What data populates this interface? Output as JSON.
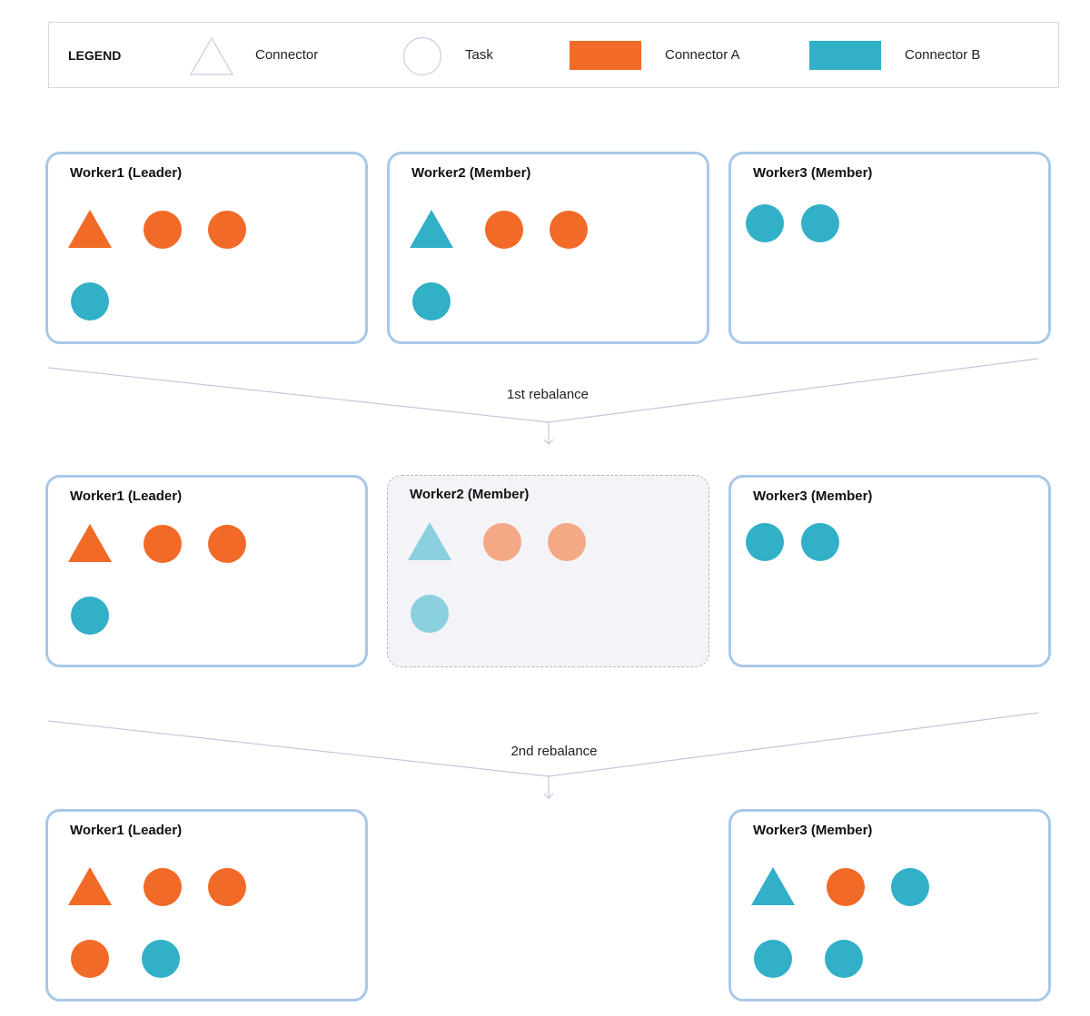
{
  "colors": {
    "connector_a": "#f26a27",
    "connector_b": "#31b0c8",
    "connector_a_faded": "#f3a986",
    "connector_b_faded": "#8ad0de",
    "border": "#a9c8e8",
    "line": "#c4c7dc"
  },
  "legend": {
    "title": "LEGEND",
    "items": [
      {
        "label": "Connector",
        "icon": "triangle-outline-icon"
      },
      {
        "label": "Task",
        "icon": "circle-outline-icon"
      },
      {
        "label": "Connector A",
        "icon": "orange-swatch"
      },
      {
        "label": "Connector B",
        "icon": "teal-swatch"
      }
    ]
  },
  "transitions": [
    {
      "label": "1st rebalance"
    },
    {
      "label": "2nd rebalance"
    }
  ],
  "stages": [
    {
      "workers": [
        {
          "title": "Worker1 (Leader)",
          "state": "active",
          "rows": [
            [
              {
                "type": "connector",
                "owner": "a"
              },
              {
                "type": "task",
                "owner": "a"
              },
              {
                "type": "task",
                "owner": "a"
              }
            ],
            [
              {
                "type": "task",
                "owner": "b"
              }
            ]
          ]
        },
        {
          "title": "Worker2 (Member)",
          "state": "active",
          "rows": [
            [
              {
                "type": "connector",
                "owner": "b"
              },
              {
                "type": "task",
                "owner": "a"
              },
              {
                "type": "task",
                "owner": "a"
              }
            ],
            [
              {
                "type": "task",
                "owner": "b"
              }
            ]
          ]
        },
        {
          "title": "Worker3 (Member)",
          "state": "active",
          "rows": [
            [
              {
                "type": "task",
                "owner": "b"
              },
              {
                "type": "task",
                "owner": "b"
              }
            ]
          ]
        }
      ]
    },
    {
      "workers": [
        {
          "title": "Worker1 (Leader)",
          "state": "active",
          "rows": [
            [
              {
                "type": "connector",
                "owner": "a"
              },
              {
                "type": "task",
                "owner": "a"
              },
              {
                "type": "task",
                "owner": "a"
              }
            ],
            [
              {
                "type": "task",
                "owner": "b"
              }
            ]
          ]
        },
        {
          "title": "Worker2 (Member)",
          "state": "lost",
          "rows": [
            [
              {
                "type": "connector",
                "owner": "b"
              },
              {
                "type": "task",
                "owner": "a"
              },
              {
                "type": "task",
                "owner": "a"
              }
            ],
            [
              {
                "type": "task",
                "owner": "b"
              }
            ]
          ]
        },
        {
          "title": "Worker3 (Member)",
          "state": "active",
          "rows": [
            [
              {
                "type": "task",
                "owner": "b"
              },
              {
                "type": "task",
                "owner": "b"
              }
            ]
          ]
        }
      ]
    },
    {
      "workers": [
        {
          "title": "Worker1 (Leader)",
          "state": "active",
          "rows": [
            [
              {
                "type": "connector",
                "owner": "a"
              },
              {
                "type": "task",
                "owner": "a"
              },
              {
                "type": "task",
                "owner": "a"
              }
            ],
            [
              {
                "type": "task",
                "owner": "a"
              },
              {
                "type": "task",
                "owner": "b"
              }
            ]
          ]
        },
        null,
        {
          "title": "Worker3 (Member)",
          "state": "active",
          "rows": [
            [
              {
                "type": "connector",
                "owner": "b"
              },
              {
                "type": "task",
                "owner": "a"
              },
              {
                "type": "task",
                "owner": "b"
              }
            ],
            [
              {
                "type": "task",
                "owner": "b"
              },
              {
                "type": "task",
                "owner": "b"
              }
            ]
          ]
        }
      ]
    }
  ]
}
